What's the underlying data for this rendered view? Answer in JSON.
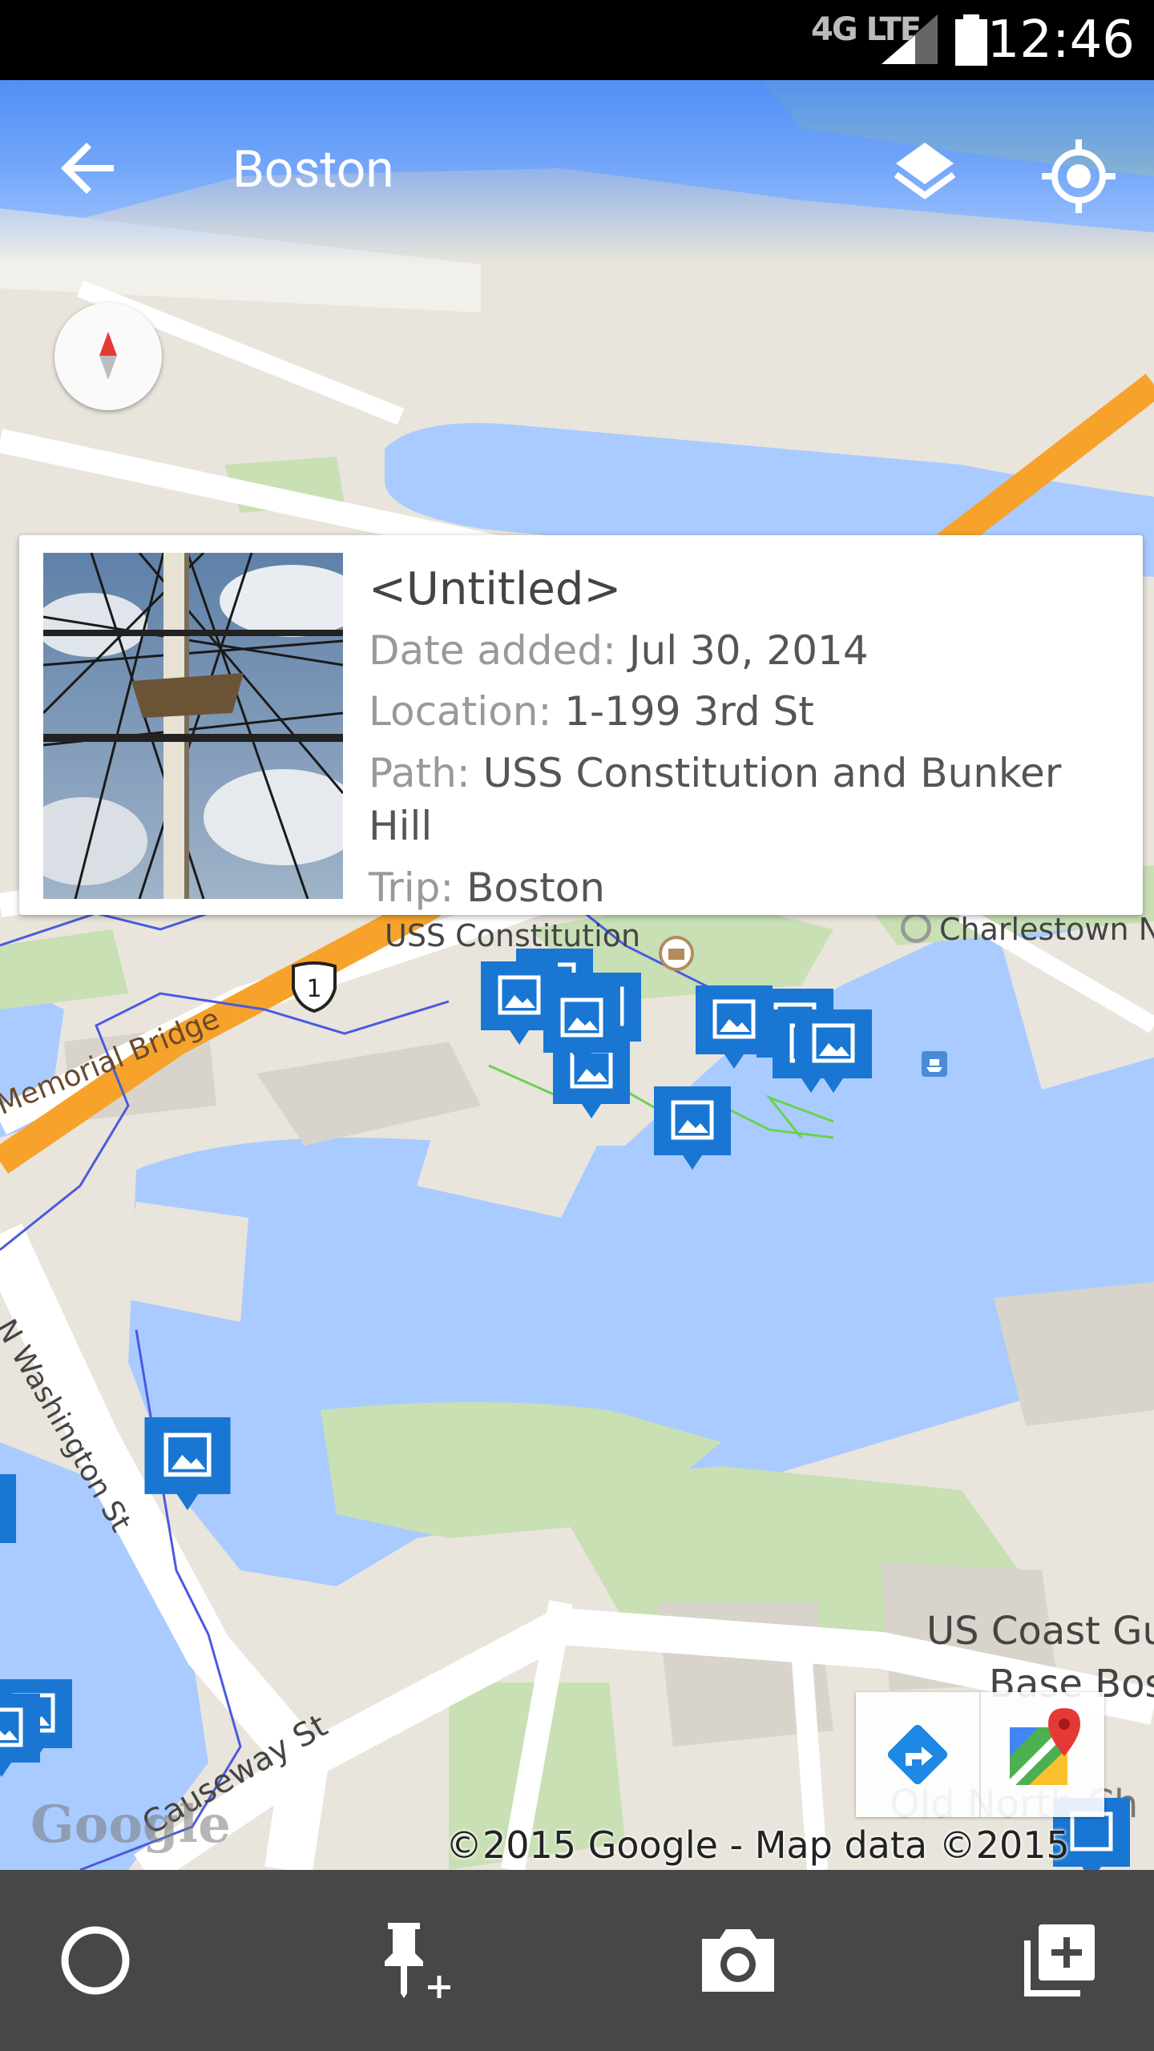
{
  "status_bar": {
    "network": "4G LTE",
    "time": "12:46"
  },
  "app_bar": {
    "title": "Boston",
    "back_icon": "arrow-back-icon",
    "layers_icon": "layers-icon",
    "my_location_icon": "my-location-icon"
  },
  "info_window": {
    "title": "<Untitled>",
    "date_label": "Date added: ",
    "date_value": "Jul 30, 2014",
    "location_label": "Location: ",
    "location_value": "1-199 3rd St",
    "path_label": "Path: ",
    "path_value": "USS Constitution and Bunker Hill",
    "trip_label": "Trip: ",
    "trip_value": "Boston"
  },
  "map_labels": {
    "uss_constitution": "USS Constitution",
    "charlestown": "Charlestown N",
    "memorial_bridge": "Memorial Bridge",
    "n_washington": "N Washington St",
    "causeway": "Causeway St",
    "coast_guard_1": "US Coast Gu",
    "coast_guard_2": "Base Bos",
    "old_north": "Old North Ch",
    "route_shield": "1"
  },
  "map_attribution": {
    "logo": "Google",
    "copyright": "©2015 Google - Map data ©2015 Google"
  },
  "bottom_bar": {
    "record_icon": "record-circle-icon",
    "add_pin_icon": "add-pin-icon",
    "camera_icon": "camera-icon",
    "add_box_icon": "add-box-icon"
  },
  "colors": {
    "accent": "#4285F4",
    "marker": "#1976D2",
    "water": "#AACBFF",
    "land": "#E9E5DC",
    "park": "#C8E0B4",
    "highway": "#F7A32B",
    "bottom_bar": "#474747"
  }
}
